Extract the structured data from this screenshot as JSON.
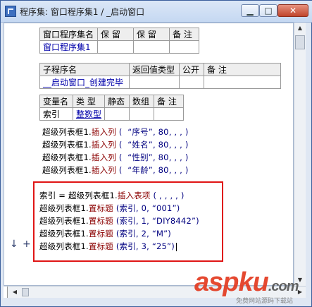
{
  "window": {
    "title": "程序集: 窗口程序集1 / _启动窗口",
    "minimize_glyph": "▁",
    "maximize_glyph": "□",
    "close_glyph": "✕"
  },
  "assembly_table": {
    "headers": [
      "窗口程序集名",
      "保 留",
      "保 留",
      "备 注"
    ],
    "row": [
      "窗口程序集1",
      "",
      "",
      ""
    ]
  },
  "sub_table": {
    "headers": [
      "子程序名",
      "返回值类型",
      "公开",
      "备 注"
    ],
    "row": [
      "__启动窗口_创建完毕",
      "",
      "",
      ""
    ]
  },
  "var_table": {
    "headers": [
      "变量名",
      "类 型",
      "静态",
      "数组",
      "备 注"
    ],
    "row": [
      "索引",
      "整数型",
      "",
      "",
      ""
    ]
  },
  "code_lines": [
    {
      "obj": "超级列表框1.",
      "fn": "插入列",
      "args": " (  “序号”, 80, , , )"
    },
    {
      "obj": "超级列表框1.",
      "fn": "插入列",
      "args": " (  “姓名”, 80, , , )"
    },
    {
      "obj": "超级列表框1.",
      "fn": "插入列",
      "args": " (  “性别”, 80, , , )"
    },
    {
      "obj": "超级列表框1.",
      "fn": "插入列",
      "args": " (  “年龄”, 80, , , )"
    }
  ],
  "highlighted_lines": [
    {
      "obj": "索引 = 超级列表框1.",
      "fn": "插入表项",
      "args": " ( , , , , )"
    },
    {
      "obj": "超级列表框1.",
      "fn": "置标题",
      "args": " (索引, 0, “001”)"
    },
    {
      "obj": "超级列表框1.",
      "fn": "置标题",
      "args": " (索引, 1, “DIY8442”)"
    },
    {
      "obj": "超级列表框1.",
      "fn": "置标题",
      "args": " (索引, 2, “M”)"
    },
    {
      "obj": "超级列表框1.",
      "fn": "置标题",
      "args": " (索引, 3, “25”)"
    }
  ],
  "markers": {
    "arrow": "↓",
    "plus": "+"
  },
  "watermark": {
    "brand_a": "asp",
    "brand_b": "ku",
    "brand_c": ".com",
    "sub": "免费网站源码下载站"
  },
  "colors": {
    "highlight_box": "#e01515",
    "value_text": "#0000aa",
    "function_text": "#8b0000"
  },
  "scroll": {
    "up": "▲",
    "down": "▼",
    "left": "◀",
    "right": "▶"
  }
}
